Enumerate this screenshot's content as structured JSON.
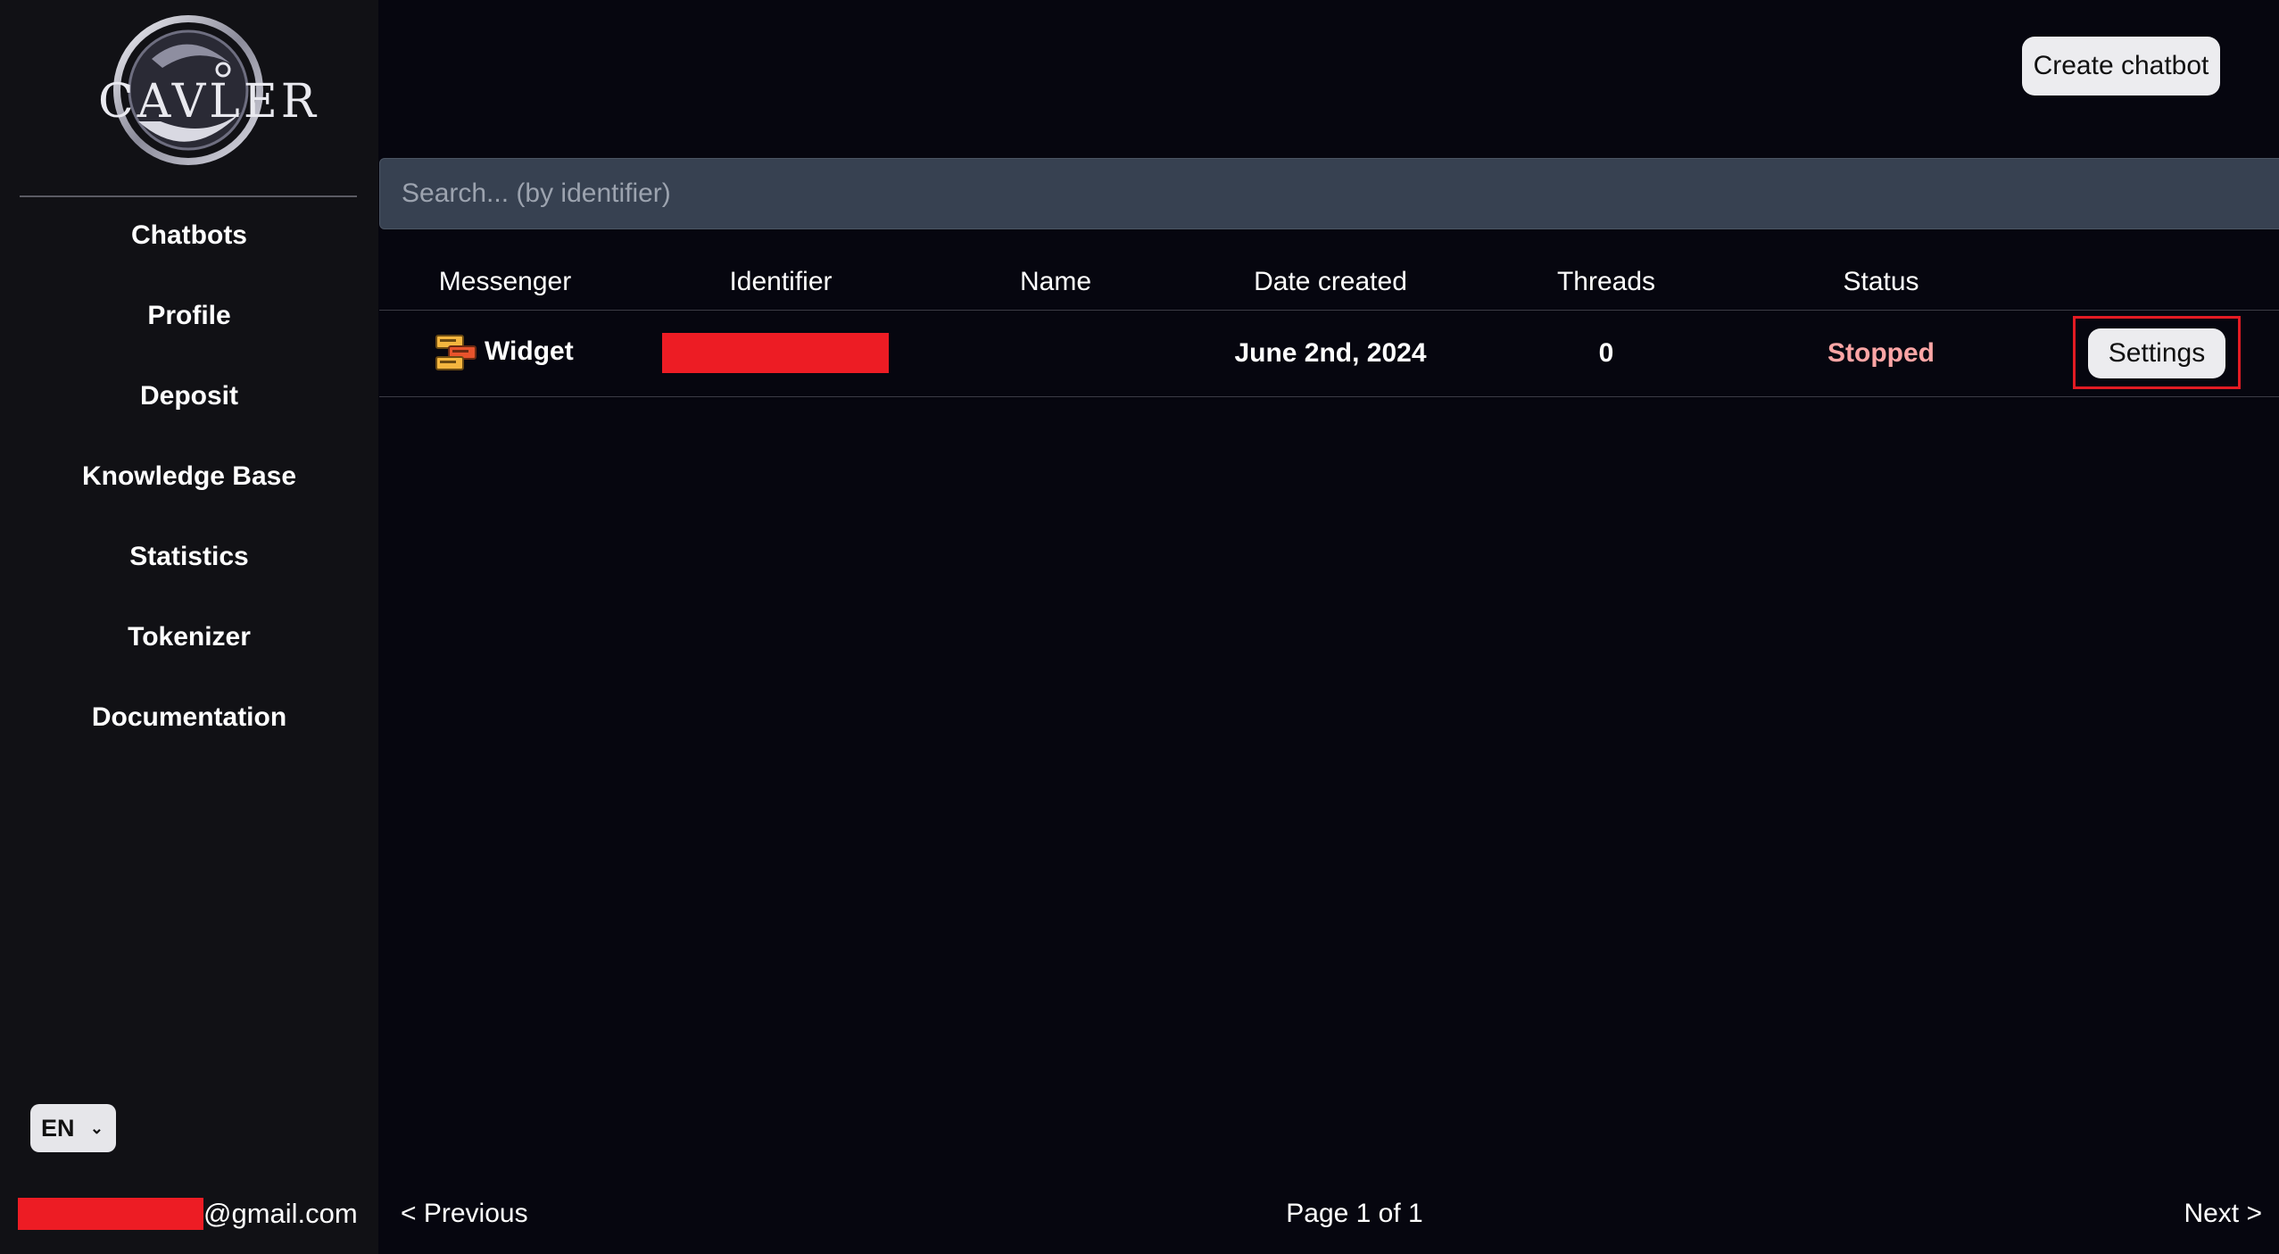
{
  "brand": {
    "logo_text": "CAVLER"
  },
  "sidebar": {
    "items": [
      {
        "label": "Chatbots"
      },
      {
        "label": "Profile"
      },
      {
        "label": "Deposit"
      },
      {
        "label": "Knowledge Base"
      },
      {
        "label": "Statistics"
      },
      {
        "label": "Tokenizer"
      },
      {
        "label": "Documentation"
      }
    ],
    "language": "EN",
    "user_email_suffix": "@gmail.com"
  },
  "header": {
    "create_label": "Create chatbot"
  },
  "search": {
    "placeholder": "Search... (by identifier)"
  },
  "table": {
    "columns": [
      "Messenger",
      "Identifier",
      "Name",
      "Date created",
      "Threads",
      "Status"
    ],
    "rows": [
      {
        "messenger": "Widget",
        "identifier": "",
        "name": "",
        "date_created": "June 2nd, 2024",
        "threads": "0",
        "status": "Stopped",
        "action_label": "Settings"
      }
    ]
  },
  "pagination": {
    "previous": "< Previous",
    "page_info": "Page 1 of 1",
    "next": "Next >"
  },
  "colors": {
    "background": "#06060f",
    "sidebar": "#111115",
    "status_stopped": "#fca5a5",
    "highlight_frame": "#e31b23",
    "redaction": "#ed1c24"
  }
}
